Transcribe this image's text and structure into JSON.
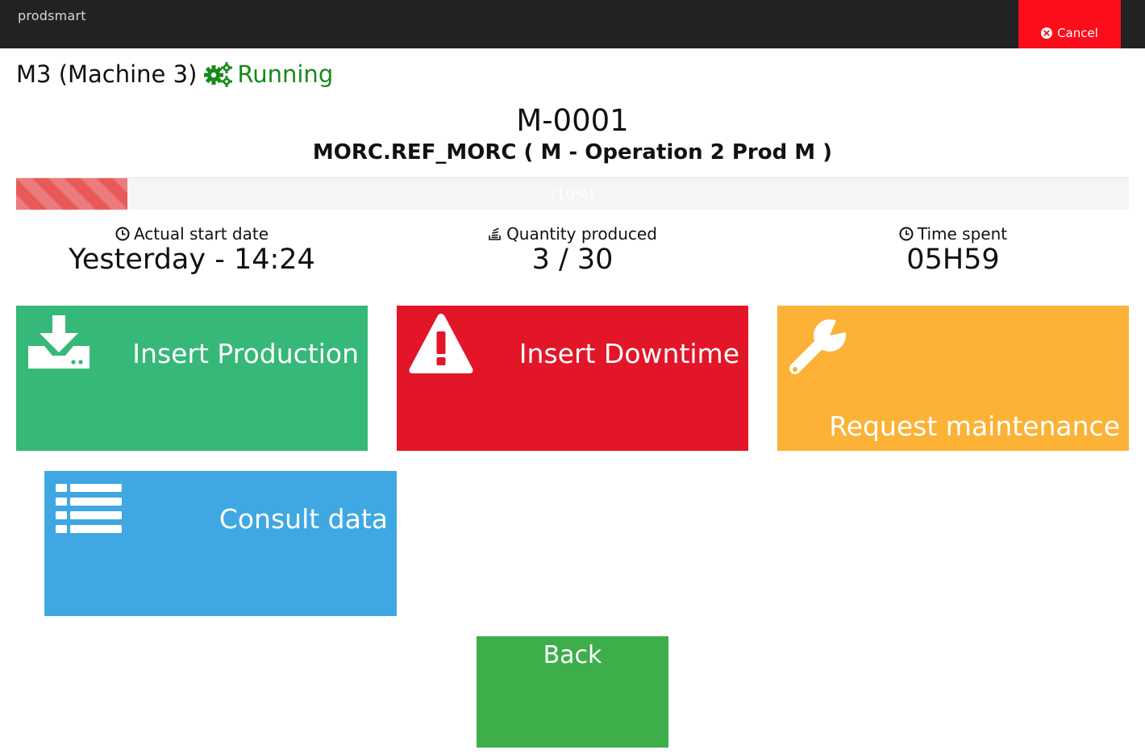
{
  "header": {
    "brand": "prodsmart",
    "cancel_label": "Cancel"
  },
  "machine": {
    "name": "M3 (Machine 3)",
    "status": "Running",
    "status_color": "#178a1c"
  },
  "order": {
    "code": "M-0001",
    "operation": "MORC.REF_MORC ( M - Operation 2 Prod M )"
  },
  "progress": {
    "value_percent": 10,
    "label": "(10%)"
  },
  "stats": {
    "start_date": {
      "label": "Actual start date",
      "value": "Yesterday - 14:24"
    },
    "quantity": {
      "label": "Quantity produced",
      "value": "3 / 30"
    },
    "time_spent": {
      "label": "Time spent",
      "value": "05H59"
    }
  },
  "actions": {
    "insert_production": {
      "label": "Insert Production",
      "color": "#35b878",
      "icon": "download-icon"
    },
    "insert_downtime": {
      "label": "Insert Downtime",
      "color": "#e31528",
      "icon": "warning-icon"
    },
    "request_maintenance": {
      "label": "Request maintenance",
      "color": "#fbb236",
      "icon": "wrench-icon"
    },
    "consult_data": {
      "label": "Consult data",
      "color": "#3fa8e2",
      "icon": "list-icon"
    }
  },
  "back_label": "Back"
}
